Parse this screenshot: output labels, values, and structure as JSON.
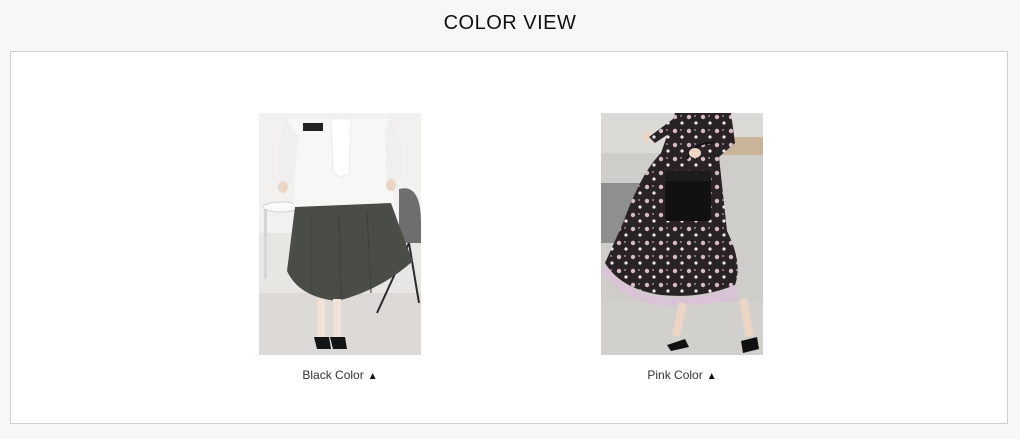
{
  "header": {
    "title": "COLOR VIEW"
  },
  "products": [
    {
      "caption": "Black Color",
      "arrow_icon": "triangle-up-icon",
      "colors": {
        "background": "#e6e4e1",
        "blouse": "#f4f4f2",
        "skirt": "#4a4c46",
        "shoes": "#151515"
      }
    },
    {
      "caption": "Pink Color",
      "arrow_icon": "triangle-up-icon",
      "colors": {
        "background": "#dcdad6",
        "dress": "#2a2326",
        "hem": "#d9c3d6",
        "bag": "#111111"
      }
    }
  ]
}
